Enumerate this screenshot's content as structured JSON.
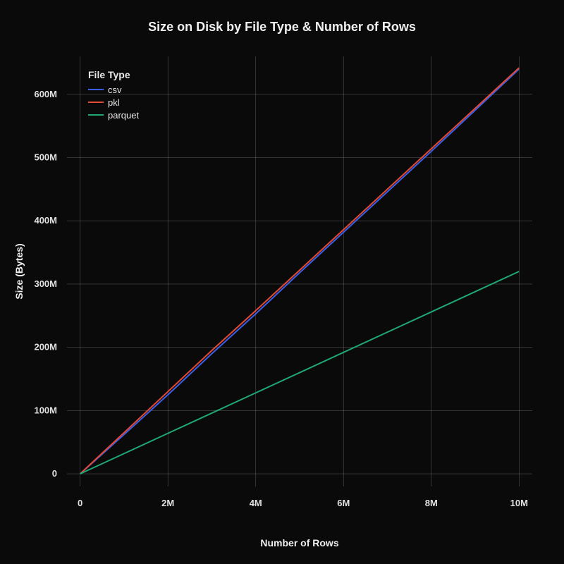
{
  "chart_data": {
    "type": "line",
    "title": "Size on Disk by File Type & Number of Rows",
    "xlabel": "Number of Rows",
    "ylabel": "Size (Bytes)",
    "xlim": [
      -300000,
      10300000
    ],
    "ylim": [
      -20000000,
      660000000
    ],
    "x_ticks": [
      0,
      2000000,
      4000000,
      6000000,
      8000000,
      10000000
    ],
    "x_tick_labels": [
      "0",
      "2M",
      "4M",
      "6M",
      "8M",
      "10M"
    ],
    "y_ticks": [
      0,
      100000000,
      200000000,
      300000000,
      400000000,
      500000000,
      600000000
    ],
    "y_tick_labels": [
      "0",
      "100M",
      "200M",
      "300M",
      "400M",
      "500M",
      "600M"
    ],
    "legend_title": "File Type",
    "series": [
      {
        "name": "csv",
        "color": "#3b5ee8",
        "x": [
          0,
          1000000,
          2000000,
          3000000,
          4000000,
          5000000,
          6000000,
          7000000,
          8000000,
          9000000,
          10000000
        ],
        "y": [
          0,
          62000000,
          125000000,
          190000000,
          253000000,
          318000000,
          382000000,
          446000000,
          510000000,
          575000000,
          640000000
        ]
      },
      {
        "name": "pkl",
        "color": "#e34a33",
        "x": [
          0,
          1000000,
          2000000,
          3000000,
          4000000,
          5000000,
          6000000,
          7000000,
          8000000,
          9000000,
          10000000
        ],
        "y": [
          0,
          65000000,
          130000000,
          195000000,
          258000000,
          322000000,
          386000000,
          450000000,
          514000000,
          578000000,
          642000000
        ]
      },
      {
        "name": "parquet",
        "color": "#1fa774",
        "x": [
          0,
          1000000,
          2000000,
          3000000,
          4000000,
          5000000,
          6000000,
          7000000,
          8000000,
          9000000,
          10000000
        ],
        "y": [
          0,
          32000000,
          64000000,
          96000000,
          128000000,
          160000000,
          192000000,
          224000000,
          256000000,
          288000000,
          320000000
        ]
      }
    ]
  }
}
